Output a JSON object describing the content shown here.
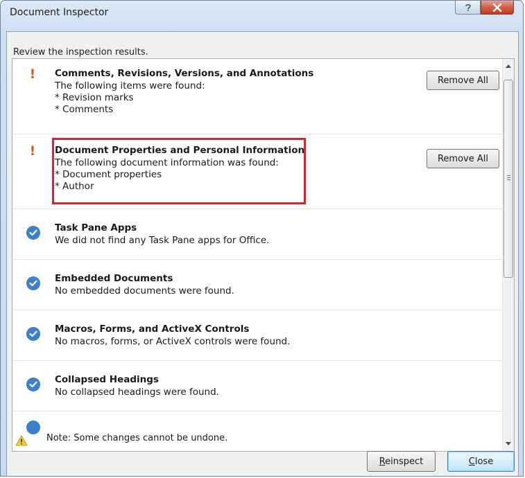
{
  "window": {
    "title": "Document Inspector"
  },
  "review_label": "Review the inspection results.",
  "results": [
    {
      "status": "found",
      "icon": "warning-exclamation-icon",
      "title": "Comments, Revisions, Versions, and Annotations",
      "description": "The following items were found:",
      "details": [
        "* Revision marks",
        "* Comments"
      ],
      "button_label": "Remove All"
    },
    {
      "status": "found",
      "icon": "warning-exclamation-icon",
      "title": "Document Properties and Personal Information",
      "description": "The following document information was found:",
      "details": [
        "* Document properties",
        "* Author"
      ],
      "button_label": "Remove All",
      "highlighted": true
    },
    {
      "status": "clear",
      "icon": "checkmark-icon",
      "title": "Task Pane Apps",
      "description": "We did not find any Task Pane apps for Office."
    },
    {
      "status": "clear",
      "icon": "checkmark-icon",
      "title": "Embedded Documents",
      "description": "No embedded documents were found."
    },
    {
      "status": "clear",
      "icon": "checkmark-icon",
      "title": "Macros, Forms, and ActiveX Controls",
      "description": "No macros, forms, or ActiveX controls were found."
    },
    {
      "status": "clear",
      "icon": "checkmark-icon",
      "title": "Collapsed Headings",
      "description": "No collapsed headings were found."
    }
  ],
  "note": "Note: Some changes cannot be undone.",
  "buttons": {
    "reinspect": "Reinspect",
    "close": "Close"
  },
  "colors": {
    "warning": "#e0561c",
    "check": "#3d80c9",
    "highlight_border": "#d7232a",
    "close_button": "#c13b20"
  }
}
